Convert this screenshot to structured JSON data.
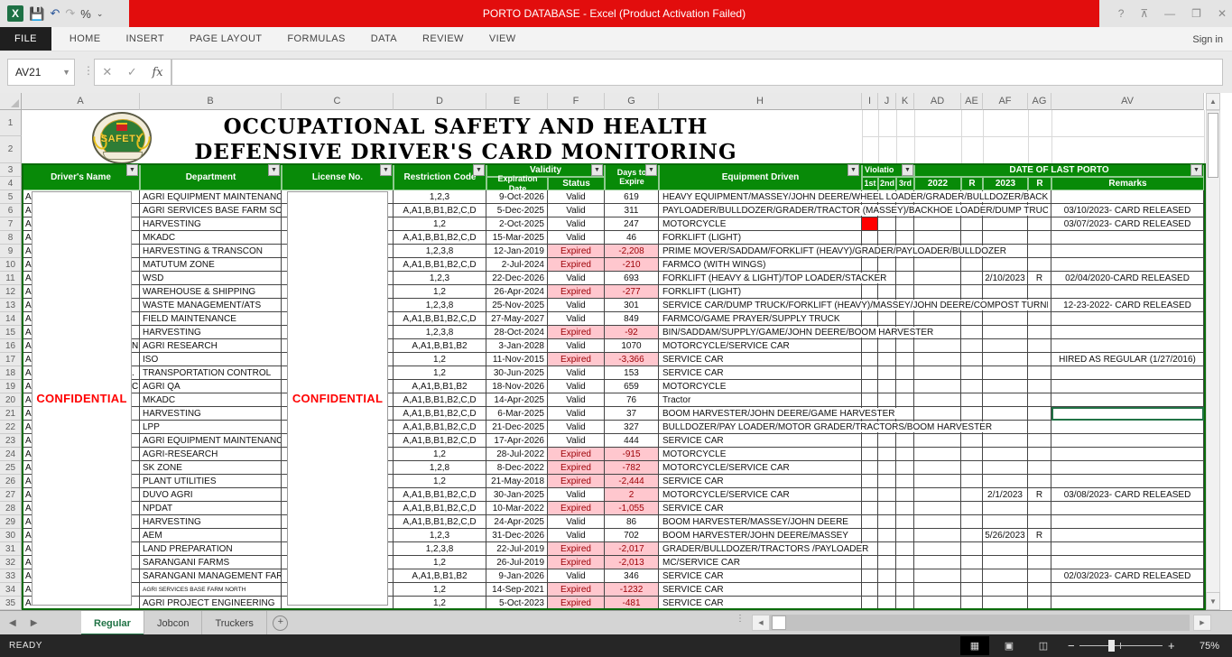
{
  "titlebar": {
    "title": "PORTO DATABASE -  Excel (Product Activation Failed)",
    "qat": {
      "excel_icon": "X",
      "save": "💾",
      "undo": "↶",
      "redo": "↷",
      "percent": "%",
      "customize": "⌄"
    },
    "window_controls": {
      "help": "?",
      "ribbon_options": "⊼",
      "minimize": "—",
      "restore": "❐",
      "close": "✕"
    }
  },
  "ribbon": {
    "tabs": [
      "FILE",
      "HOME",
      "INSERT",
      "PAGE LAYOUT",
      "FORMULAS",
      "DATA",
      "REVIEW",
      "VIEW"
    ],
    "sign_in": "Sign in"
  },
  "formula_bar": {
    "name_box": "AV21",
    "cancel": "✕",
    "enter": "✓",
    "fx": "fx",
    "formula_value": ""
  },
  "sheet": {
    "column_letters": [
      "A",
      "B",
      "C",
      "D",
      "E",
      "F",
      "G",
      "H",
      "I",
      "J",
      "K",
      "AD",
      "AE",
      "AF",
      "AG",
      "AV"
    ],
    "title_line1": "OCCUPATIONAL SAFETY AND HEALTH",
    "title_line2": "DEFENSIVE DRIVER'S CARD MONITORING",
    "logo_text": "SAFETY",
    "confidential": "CONFIDENTIAL",
    "headers": {
      "drivers_name": "Driver's Name",
      "department": "Department",
      "license_no": "License No.",
      "restriction_code": "Restriction Code",
      "validity": "Validity",
      "expiration_date": "Expiration Date",
      "status": "Status",
      "days_line1": "Days to",
      "days_line2": "Expire",
      "equipment_driven": "Equipment Driven",
      "violations": "Violatio",
      "v1": "1st",
      "v2": "2nd",
      "v3": "3rd",
      "date_of_last_porto": "DATE OF LAST PORTO",
      "y2022": "2022",
      "r1": "R",
      "y2023": "2023",
      "r2": "R",
      "remarks": "Remarks"
    },
    "rows": [
      {
        "n": 5,
        "a": "AB",
        "dept": "AGRI EQUIPMENT MAINTENANCE",
        "rc": "1,2,3",
        "exp": "9-Oct-2026",
        "st": "Valid",
        "days": "619",
        "eq": "HEAVY EQUIPMENT/MASSEY/JOHN DEERE/WHEEL LOADER/GRADER/BULLDOZER/BACKHOE"
      },
      {
        "n": 6,
        "a": "AB",
        "dept": "AGRI SERVICES BASE FARM SOUTH",
        "rc": "A,A1,B,B1,B2,C,D",
        "exp": "5-Dec-2025",
        "st": "Valid",
        "days": "311",
        "eq": "PAYLOADER/BULLDOZER/GRADER/TRACTOR (MASSEY)/BACKHOE LOADER/DUMP TRUCK",
        "rem": "03/10/2023- CARD RELEASED"
      },
      {
        "n": 7,
        "a": "AB",
        "dept": "HARVESTING",
        "rc": "1,2",
        "exp": "2-Oct-2025",
        "st": "Valid",
        "days": "247",
        "eq": "MOTORCYCLE",
        "v1": true,
        "rem": "03/07/2023- CARD RELEASED"
      },
      {
        "n": 8,
        "a": "AB",
        "dept": "MKADC",
        "rc": "A,A1,B,B1,B2,C,D",
        "exp": "15-Mar-2025",
        "st": "Valid",
        "days": "46",
        "eq": "FORKLIFT (LIGHT)"
      },
      {
        "n": 9,
        "a": "AB",
        "dept": "HARVESTING & TRANSCON",
        "rc": "1,2,3,8",
        "exp": "12-Jan-2019",
        "st": "Expired",
        "days": "-2,208",
        "eq": "PRIME MOVER/SADDAM/FORKLIFT (HEAVY)/GRADER/PAYLOADER/BULLDOZER"
      },
      {
        "n": 10,
        "a": "AB",
        "dept": "MATUTUM ZONE",
        "rc": "A,A1,B,B1,B2,C,D",
        "exp": "2-Jul-2024",
        "st": "Expired",
        "days": "-210",
        "eq": "FARMCO (WITH WINGS)"
      },
      {
        "n": 11,
        "a": "AB",
        "dept": "WSD",
        "rc": "1,2,3",
        "exp": "22-Dec-2026",
        "st": "Valid",
        "days": "693",
        "eq": "FORKLIFT (HEAVY & LIGHT)/TOP LOADER/STACKER",
        "d2023": "2/10/2023",
        "r2": "R",
        "rem": "02/04/2020-CARD RELEASED"
      },
      {
        "n": 12,
        "a": "AB",
        "dept": "WAREHOUSE & SHIPPING",
        "rc": "1,2",
        "exp": "26-Apr-2024",
        "st": "Expired",
        "days": "-277",
        "eq": "FORKLIFT (LIGHT)"
      },
      {
        "n": 13,
        "a": "AB",
        "dept": "WASTE MANAGEMENT/ATS",
        "rc": "1,2,3,8",
        "exp": "25-Nov-2025",
        "st": "Valid",
        "days": "301",
        "eq": "SERVICE CAR/DUMP TRUCK/FORKLIFT (HEAVY)/MASSEY/JOHN DEERE/COMPOST TURNER",
        "rem": "12-23-2022- CARD RELEASED"
      },
      {
        "n": 14,
        "a": "AB",
        "dept": "FIELD MAINTENANCE",
        "rc": "A,A1,B,B1,B2,C,D",
        "exp": "27-May-2027",
        "st": "Valid",
        "days": "849",
        "eq": "FARMCO/GAME PRAYER/SUPPLY TRUCK"
      },
      {
        "n": 15,
        "a": "AB",
        "dept": "HARVESTING",
        "rc": "1,2,3,8",
        "exp": "28-Oct-2024",
        "st": "Expired",
        "days": "-92",
        "eq": "BIN/SADDAM/SUPPLY/GAME/JOHN DEERE/BOOM HARVESTER"
      },
      {
        "n": 16,
        "a": "AB",
        "tail": "N",
        "dept": "AGRI RESEARCH",
        "rc": "A,A1,B,B1,B2",
        "exp": "3-Jan-2028",
        "st": "Valid",
        "days": "1070",
        "eq": "MOTORCYCLE/SERVICE CAR"
      },
      {
        "n": 17,
        "a": "AB",
        "dept": "ISO",
        "rc": "1,2",
        "exp": "11-Nov-2015",
        "st": "Expired",
        "days": "-3,366",
        "eq": "SERVICE CAR",
        "rem": "HIRED AS REGULAR (1/27/2016)"
      },
      {
        "n": 18,
        "a": "AB",
        "tail": ".",
        "dept": "TRANSPORTATION CONTROL",
        "rc": "1,2",
        "exp": "30-Jun-2025",
        "st": "Valid",
        "days": "153",
        "eq": "SERVICE CAR"
      },
      {
        "n": 19,
        "a": "AB",
        "tail": "C",
        "dept": "AGRI QA",
        "rc": "A,A1,B,B1,B2",
        "exp": "18-Nov-2026",
        "st": "Valid",
        "days": "659",
        "eq": "MOTORCYCLE"
      },
      {
        "n": 20,
        "a": "AB",
        "dept": "MKADC",
        "rc": "A,A1,B,B1,B2,C,D",
        "exp": "14-Apr-2025",
        "st": "Valid",
        "days": "76",
        "eq": "Tractor"
      },
      {
        "n": 21,
        "a": "AB",
        "dept": "HARVESTING",
        "rc": "A,A1,B,B1,B2,C,D",
        "exp": "6-Mar-2025",
        "st": "Valid",
        "days": "37",
        "eq": "BOOM HARVESTER/JOHN DEERE/GAME HARVESTER"
      },
      {
        "n": 22,
        "a": "AB",
        "dept": "LPP",
        "rc": "A,A1,B,B1,B2,C,D",
        "exp": "21-Dec-2025",
        "st": "Valid",
        "days": "327",
        "eq": "BULLDOZER/PAY LOADER/MOTOR GRADER/TRACTORS/BOOM HARVESTER"
      },
      {
        "n": 23,
        "a": "AB",
        "dept": "AGRI EQUIPMENT MAINTENANCE",
        "rc": "A,A1,B,B1,B2,C,D",
        "exp": "17-Apr-2026",
        "st": "Valid",
        "days": "444",
        "eq": "SERVICE CAR"
      },
      {
        "n": 24,
        "a": "AB",
        "dept": "AGRI-RESEARCH",
        "rc": "1,2",
        "exp": "28-Jul-2022",
        "st": "Expired",
        "days": "-915",
        "eq": "MOTORCYCLE"
      },
      {
        "n": 25,
        "a": "AB",
        "dept": "SK ZONE",
        "rc": "1,2,8",
        "exp": "8-Dec-2022",
        "st": "Expired",
        "days": "-782",
        "eq": "MOTORCYCLE/SERVICE CAR"
      },
      {
        "n": 26,
        "a": "AB",
        "dept": "PLANT UTILITIES",
        "rc": "1,2",
        "exp": "21-May-2018",
        "st": "Expired",
        "days": "-2,444",
        "eq": "SERVICE CAR"
      },
      {
        "n": 27,
        "a": "AB",
        "dept": "DUVO AGRI",
        "rc": "A,A1,B,B1,B2,C,D",
        "exp": "30-Jan-2025",
        "st": "Valid",
        "days": "2",
        "days_alert": true,
        "eq": "MOTORCYCLE/SERVICE CAR",
        "d2023": "2/1/2023",
        "r2": "R",
        "rem": "03/08/2023- CARD RELEASED"
      },
      {
        "n": 28,
        "a": "AB",
        "dept": "NPDAT",
        "rc": "A,A1,B,B1,B2,C,D",
        "exp": "10-Mar-2022",
        "st": "Expired",
        "days": "-1,055",
        "eq": "SERVICE CAR"
      },
      {
        "n": 29,
        "a": "AB",
        "dept": "HARVESTING",
        "rc": "A,A1,B,B1,B2,C,D",
        "exp": "24-Apr-2025",
        "st": "Valid",
        "days": "86",
        "eq": "BOOM HARVESTER/MASSEY/JOHN DEERE"
      },
      {
        "n": 30,
        "a": "AB",
        "dept": "AEM",
        "rc": "1,2,3",
        "exp": "31-Dec-2026",
        "st": "Valid",
        "days": "702",
        "eq": "BOOM HARVESTER/JOHN DEERE/MASSEY",
        "d2023": "5/26/2023",
        "r2": "R"
      },
      {
        "n": 31,
        "a": "AB",
        "dept": "LAND PREPARATION",
        "rc": "1,2,3,8",
        "exp": "22-Jul-2019",
        "st": "Expired",
        "days": "-2,017",
        "eq": "GRADER/BULLDOZER/TRACTORS /PAYLOADER"
      },
      {
        "n": 32,
        "a": "AB",
        "dept": "SARANGANI FARMS",
        "rc": "1,2",
        "exp": "26-Jul-2019",
        "st": "Expired",
        "days": "-2,013",
        "eq": "MC/SERVICE CAR"
      },
      {
        "n": 33,
        "a": "AB",
        "dept": "SARANGANI MANAGEMENT FARM",
        "rc": "A,A1,B,B1,B2",
        "exp": "9-Jan-2026",
        "st": "Valid",
        "days": "346",
        "eq": "SERVICE CAR",
        "rem": "02/03/2023- CARD RELEASED"
      },
      {
        "n": 34,
        "a": "AC",
        "dept": "AGRI SERVICES BASE FARM NORTH",
        "two_line": true,
        "rc": "1,2",
        "exp": "14-Sep-2021",
        "st": "Expired",
        "days": "-1232",
        "eq": "SERVICE CAR"
      },
      {
        "n": 35,
        "a": "AC",
        "dept": "AGRI PROJECT ENGINEERING",
        "rc": "1,2",
        "exp": "5-Oct-2023",
        "st": "Expired",
        "days": "-481",
        "eq": "SERVICE CAR"
      }
    ]
  },
  "tabs_bar": {
    "nav_left": "◀",
    "nav_right": "▶",
    "sheets": [
      "Regular",
      "Jobcon",
      "Truckers"
    ],
    "active_sheet": "Regular",
    "add_sheet": "+"
  },
  "status_bar": {
    "ready": "READY",
    "zoom": "75%",
    "zoom_out": "−",
    "zoom_in": "+"
  },
  "colors": {
    "header_green": "#088A08",
    "title_red": "#E20D0D",
    "violation_red": "#FF0000",
    "expired_bg": "#FFC7CE",
    "expired_text": "#9C0006",
    "confidential_red": "#FF0000",
    "active_tab_green": "#217346"
  }
}
